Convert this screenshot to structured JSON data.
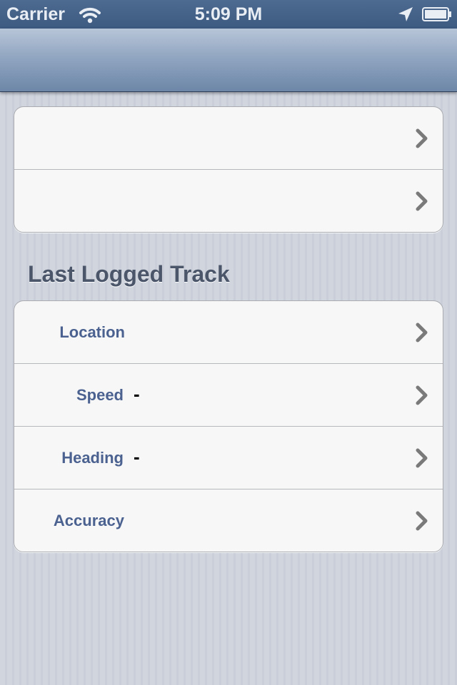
{
  "status_bar": {
    "carrier": "Carrier",
    "time": "5:09 PM",
    "wifi_icon": "wifi-icon",
    "location_icon": "location-arrow-icon",
    "battery_icon": "battery-icon"
  },
  "nav_bar": {
    "title": ""
  },
  "top_group": {
    "rows": [
      {
        "label": "",
        "accessory": "chevron-right-icon"
      },
      {
        "label": "",
        "accessory": "chevron-right-icon"
      }
    ]
  },
  "track_section": {
    "header": "Last Logged Track",
    "rows": [
      {
        "label": "Location",
        "value": ""
      },
      {
        "label": "Speed",
        "value": "-"
      },
      {
        "label": "Heading",
        "value": "-"
      },
      {
        "label": "Accuracy",
        "value": ""
      }
    ]
  },
  "colors": {
    "status_bar": "#3f5c82",
    "nav_bar_top": "#b7c5d8",
    "nav_bar_bottom": "#6d87a8",
    "background": "#cfd4dd",
    "cell_background": "#f7f7f7",
    "label_text": "#4b6290",
    "section_header_text": "#4c566a",
    "chevron": "#7a7a7a"
  }
}
